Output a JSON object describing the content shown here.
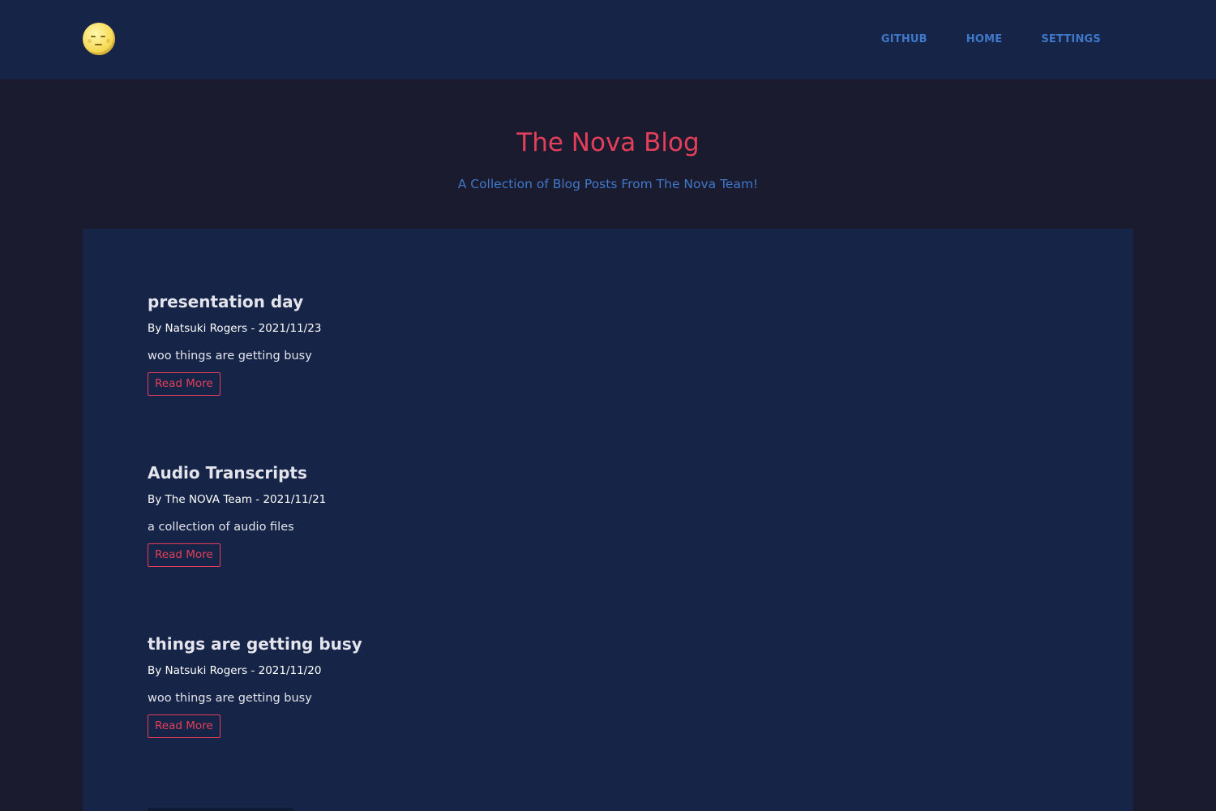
{
  "navbar": {
    "logo_icon": "full-moon-face-icon",
    "links": [
      {
        "label": "GITHUB"
      },
      {
        "label": "HOME"
      },
      {
        "label": "SETTINGS"
      }
    ],
    "link_color": "#3f78c9",
    "background": "#162447"
  },
  "hero": {
    "title": "The Nova Blog",
    "subtitle": "A Collection of Blog Posts From The Nova Team!",
    "title_color": "#e43f5a",
    "subtitle_color": "#3f78c9"
  },
  "posts": [
    {
      "title": "presentation day",
      "meta": "By Natsuki Rogers - 2021/11/23",
      "excerpt": "woo things are getting busy",
      "button": "Read More"
    },
    {
      "title": "Audio Transcripts",
      "meta": "By The NOVA Team - 2021/11/21",
      "excerpt": "a collection of audio files",
      "button": "Read More"
    },
    {
      "title": "things are getting busy",
      "meta": "By Natsuki Rogers - 2021/11/20",
      "excerpt": "woo things are getting busy",
      "button": "Read More"
    }
  ],
  "colors": {
    "page_background": "#1b1b2f",
    "panel_background": "#162447",
    "accent": "#e43f5a"
  }
}
